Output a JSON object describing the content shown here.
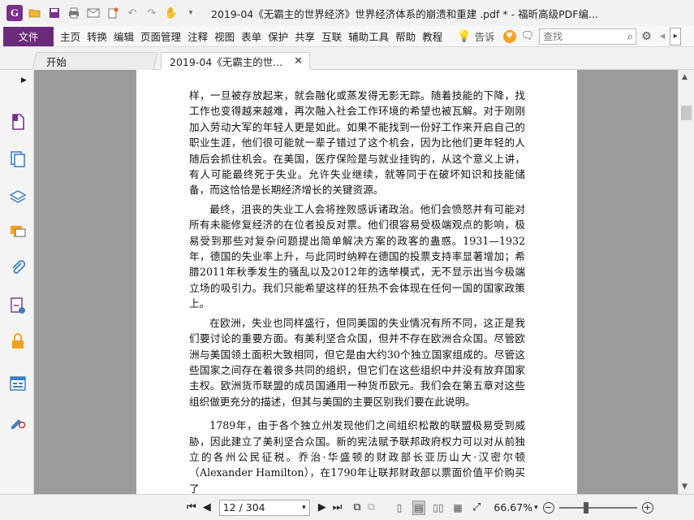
{
  "titlebar": {
    "title": "2019-04《无霸主的世界经济》世界经济体系的崩溃和重建 .pdf * - 福昕高级PDF编...",
    "quick_access": [
      "open-icon",
      "save-icon",
      "print-icon",
      "email-icon",
      "new-icon",
      "undo-icon",
      "redo-icon",
      "hand-tool-icon",
      "dropdown-icon"
    ]
  },
  "menubar": {
    "file": "文件",
    "items": [
      "主页",
      "转换",
      "编辑",
      "页面管理",
      "注释",
      "视图",
      "表单",
      "保护",
      "共享",
      "互联",
      "辅助工具",
      "帮助",
      "教程"
    ],
    "tell_me": "告诉",
    "search_placeholder": "查找"
  },
  "tabs": [
    {
      "label": "开始"
    },
    {
      "label": "2019-04《无霸主的世...",
      "active": true
    }
  ],
  "sidebar": {
    "items": [
      "pages-icon",
      "thumbnails-icon",
      "layers-icon",
      "comments-icon",
      "attachments-icon",
      "signature-icon",
      "security-icon",
      "form-fields-icon",
      "certify-icon"
    ]
  },
  "document": {
    "paragraphs": [
      {
        "continued": true,
        "text": "样，一旦被存放起来，就会融化或蒸发得无影无踪。随着技能的下降，找工作也变得越来越难，再次融入社会工作环境的希望也被瓦解。对于刚刚加入劳动大军的年轻人更是如此。如果不能找到一份好工作来开启自己的职业生涯，他们很可能就一辈子错过了这个机会，因为比他们更年轻的人随后会抓住机会。在美国，医疗保险是与就业挂钩的，从这个意义上讲，有人可能最终死于失业。允许失业继续，就等同于在破坏知识和技能储备，而这恰恰是长期经济增长的关键资源。"
      },
      {
        "continued": false,
        "text": "最终，沮丧的失业工人会将挫败感诉诸政治。他们会愤怒并有可能对所有未能修复经济的在位者投反对票。他们很容易受极端观点的影响，极易受到那些对复杂问题提出简单解决方案的政客的蛊惑。1931—1932年，德国的失业率上升，与此同时纳粹在德国的投票支持率显著增加；希腊2011年秋季发生的骚乱以及2012年的选举模式，无不显示出当今极端立场的吸引力。我们只能希望这样的狂热不会体现在任何一国的国家政策上。"
      },
      {
        "continued": false,
        "text": "在欧洲，失业也同样盛行，但同美国的失业情况有所不同，这正是我们要讨论的重要方面。有美利坚合众国，但并不存在欧洲合众国。尽管欧洲与美国领土面积大致相同，但它是由大约30个独立国家组成的。尽管这些国家之间存在着很多共同的组织，但它们在这些组织中并没有放弃国家主权。欧洲货币联盟的成员国通用一种货币欧元。我们会在第五章对这些组织做更充分的描述，但其与美国的主要区别我们要在此说明。"
      },
      {
        "continued": false,
        "gap": true,
        "text": "1789年，由于各个独立州发现他们之间组织松散的联盟极易受到威胁，因此建立了美利坚合众国。新的宪法赋予联邦政府权力可以对从前独立的各州公民征税。乔治·华盛顿的财政部长亚历山大·汉密尔顿（Alexander Hamilton），在1790年让联邦财政部以票面价值平价购买了"
      }
    ]
  },
  "statusbar": {
    "page_value": "12 / 304",
    "zoom": "66.67%"
  }
}
